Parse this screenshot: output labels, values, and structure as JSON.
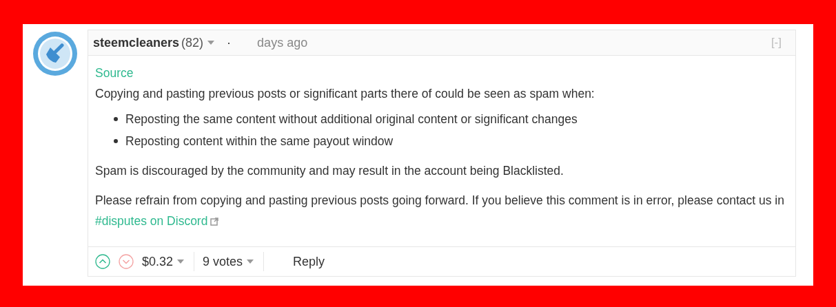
{
  "comment": {
    "author": "steemcleaners",
    "reputation": "(82)",
    "separator": "·",
    "time": "days ago",
    "collapse": "[-]",
    "source_link": "Source",
    "intro": "Copying and pasting previous posts or significant parts there of could be seen as spam when:",
    "bullets": [
      "Reposting the same content without additional original content or significant changes",
      "Reposting content within the same payout window"
    ],
    "paragraphs": [
      {
        "text": "Spam is discouraged by the community and may result in the account being Blacklisted."
      },
      {
        "text": "Please refrain from copying and pasting previous posts going forward. If you believe this comment is in error, please contact us in ",
        "link": "#disputes on Discord"
      }
    ],
    "payout": "$0.32",
    "votes": "9 votes",
    "reply": "Reply"
  }
}
